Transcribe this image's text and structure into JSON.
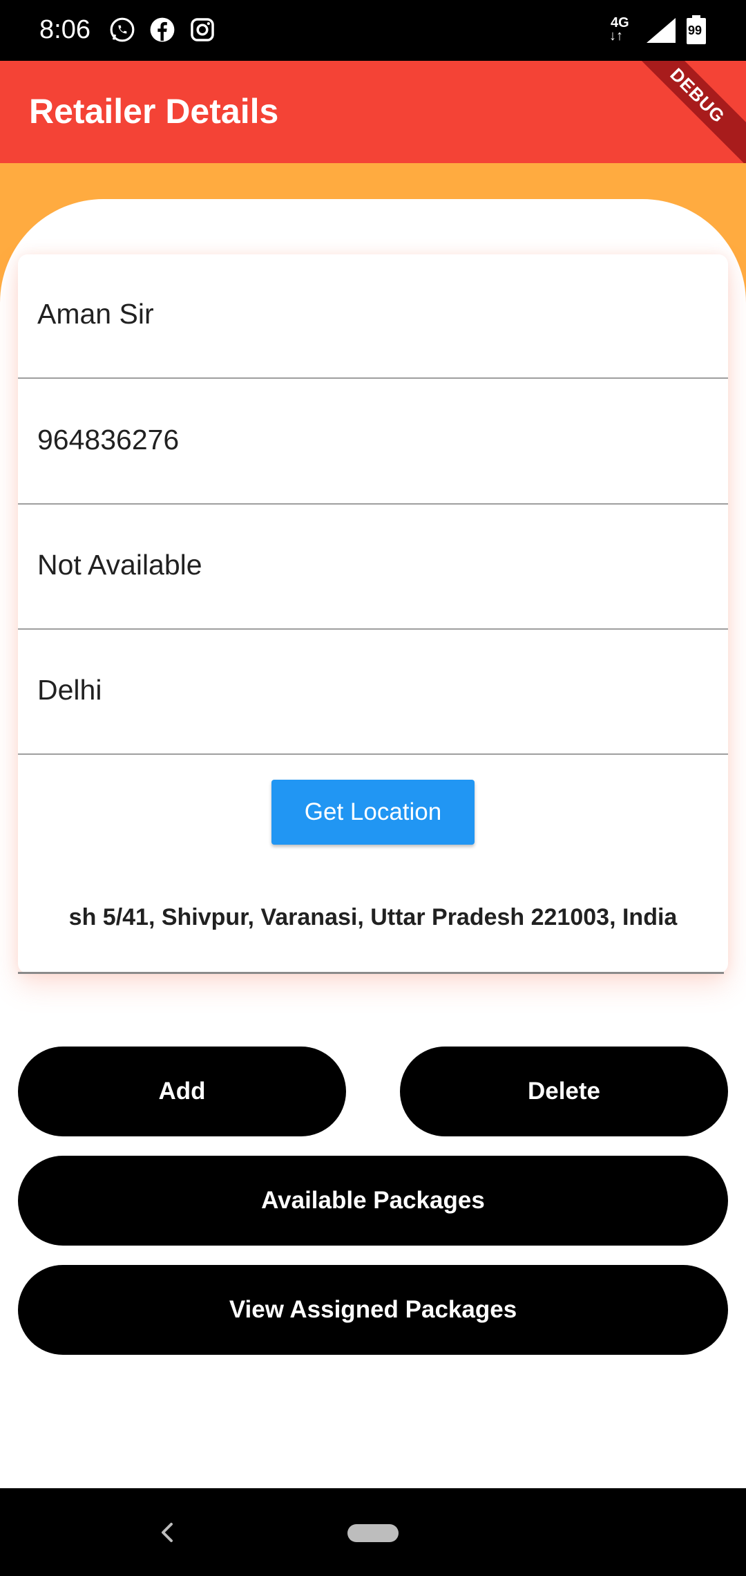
{
  "status_bar": {
    "time": "8:06",
    "network_label": "4G",
    "battery_level": "99",
    "app_icons": [
      "whatsapp-icon",
      "facebook-icon",
      "instagram-icon"
    ]
  },
  "app_bar": {
    "title": "Retailer Details",
    "debug_label": "DEBUG",
    "color": "#F44336"
  },
  "form": {
    "fields": [
      {
        "value": "Aman Sir"
      },
      {
        "value": "964836276"
      },
      {
        "value": "Not Available"
      },
      {
        "value": "Delhi"
      }
    ],
    "get_location_label": "Get Location",
    "address": "sh 5/41, Shivpur, Varanasi, Uttar Pradesh 221003, India"
  },
  "actions": {
    "add_label": "Add",
    "delete_label": "Delete",
    "available_packages_label": "Available Packages",
    "view_assigned_packages_label": "View Assigned Packages"
  },
  "colors": {
    "accent_orange": "#FFAB40",
    "button_blue": "#2196F3",
    "button_black": "#000000"
  }
}
